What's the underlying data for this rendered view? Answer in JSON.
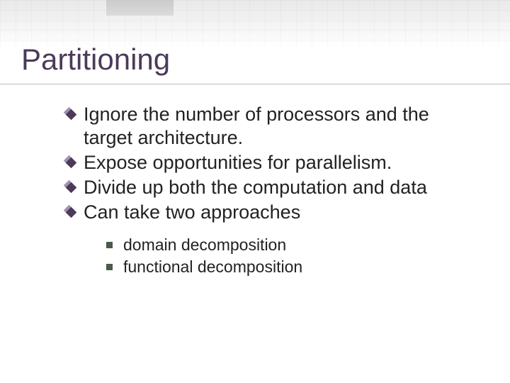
{
  "title": "Partitioning",
  "bullets": [
    "Ignore the number of processors and the target architecture.",
    "Expose opportunities for parallelism.",
    "Divide up both the computation and data",
    "Can take two approaches"
  ],
  "sub_bullets": [
    "domain decomposition",
    "functional decomposition"
  ]
}
